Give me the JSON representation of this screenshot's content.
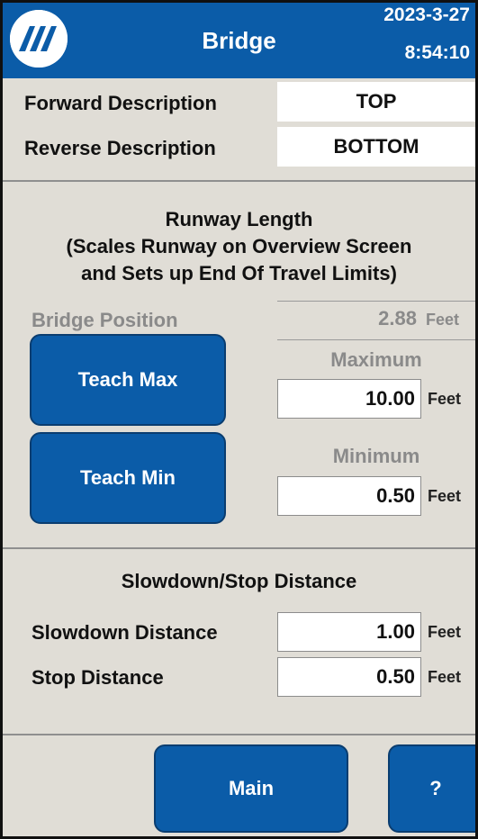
{
  "header": {
    "title": "Bridge",
    "date": "2023-3-27",
    "time": "8:54:10",
    "background_color": "#0b5ca8",
    "logo_icon": "company-logo-icon"
  },
  "descriptions": {
    "forward_label": "Forward Description",
    "forward_value": "TOP",
    "reverse_label": "Reverse Description",
    "reverse_value": "BOTTOM"
  },
  "runway": {
    "title_line1": "Runway Length",
    "title_line2": "(Scales Runway on Overview Screen",
    "title_line3": "and Sets up End Of Travel Limits)",
    "position_label": "Bridge Position",
    "position_value": "2.88",
    "position_unit": "Feet",
    "teach_max_label": "Teach Max",
    "teach_min_label": "Teach Min",
    "maximum_label": "Maximum",
    "maximum_value": "10.00",
    "maximum_unit": "Feet",
    "minimum_label": "Minimum",
    "minimum_value": "0.50",
    "minimum_unit": "Feet"
  },
  "slowdown": {
    "title": "Slowdown/Stop Distance",
    "slowdown_label": "Slowdown Distance",
    "slowdown_value": "1.00",
    "slowdown_unit": "Feet",
    "stop_label": "Stop Distance",
    "stop_value": "0.50",
    "stop_unit": "Feet"
  },
  "footer": {
    "main_label": "Main",
    "help_label": "?"
  },
  "colors": {
    "accent": "#0b5ca8",
    "panel": "#e0ddd6",
    "disabled_text": "#8a8a8a"
  }
}
